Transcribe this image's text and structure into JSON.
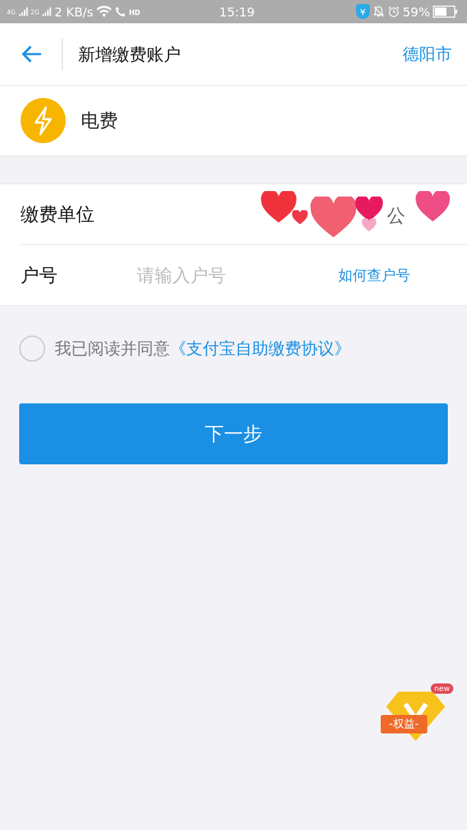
{
  "status_bar": {
    "network_1": "4G",
    "network_2": "2G",
    "speed": "2 KB/s",
    "call_badge": "HD",
    "time": "15:19",
    "shield_mark": "¥",
    "battery": "59%"
  },
  "header": {
    "title": "新增缴费账户",
    "city": "德阳市"
  },
  "service": {
    "name": "电费"
  },
  "form": {
    "rows": [
      {
        "kind": "unit",
        "label": "缴费单位",
        "value_parts": [
          "公"
        ]
      },
      {
        "kind": "input",
        "label": "户号",
        "placeholder": "请输入户号",
        "link": "如何查户号"
      }
    ]
  },
  "agreement": {
    "checked": false,
    "text": "我已阅读并同意",
    "link": "《支付宝自助缴费协议》"
  },
  "next_button": {
    "label": "下一步"
  },
  "perk_badge": {
    "label": "-权益-",
    "new_tag": "new"
  }
}
